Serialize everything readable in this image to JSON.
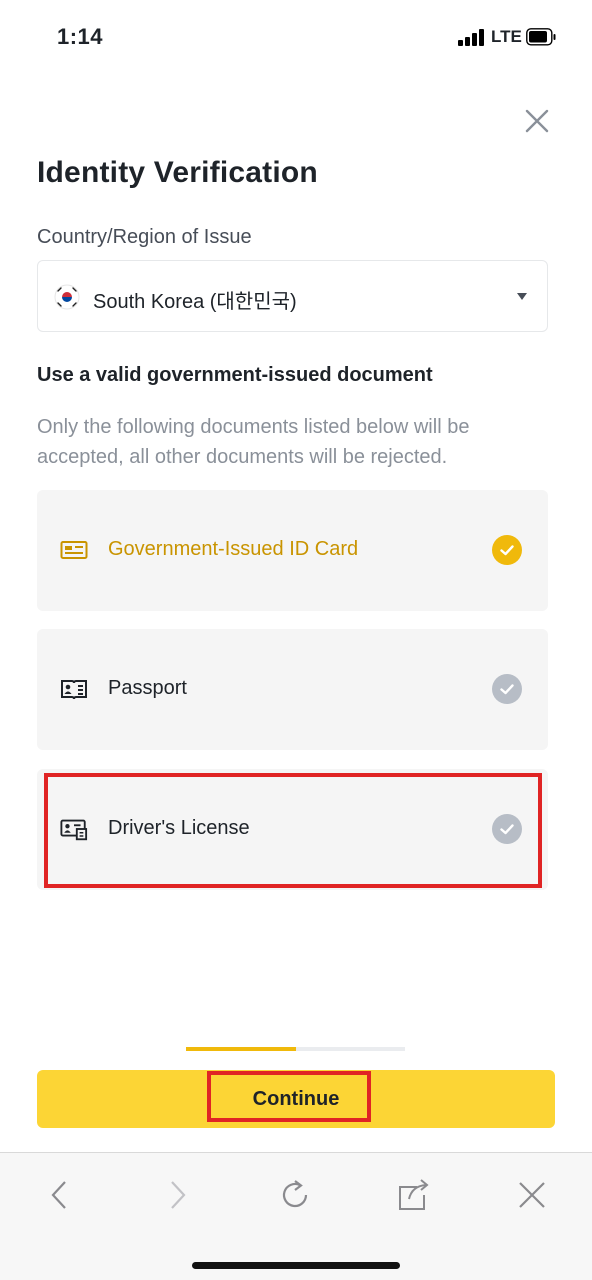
{
  "status_bar": {
    "time": "1:14",
    "network": "LTE"
  },
  "page": {
    "title": "Identity Verification",
    "country_label": "Country/Region of Issue",
    "country_value": "South Korea (대한민국)",
    "doc_heading": "Use a valid government-issued document",
    "doc_description": "Only the following documents listed below will be accepted, all other documents will be rejected."
  },
  "documents": [
    {
      "label": "Government-Issued ID Card",
      "icon": "id-card-icon",
      "selected": true
    },
    {
      "label": "Passport",
      "icon": "passport-icon",
      "selected": false
    },
    {
      "label": "Driver's License",
      "icon": "drivers-license-icon",
      "selected": false
    }
  ],
  "progress": {
    "fraction": 0.5
  },
  "continue_label": "Continue",
  "colors": {
    "accent": "#f0b90b",
    "button": "#fcd535",
    "highlight": "#e02424",
    "selected_text": "#c99400"
  },
  "toolbar": {
    "icons": [
      "back-icon",
      "forward-icon",
      "reload-icon",
      "share-icon",
      "close-icon"
    ]
  }
}
